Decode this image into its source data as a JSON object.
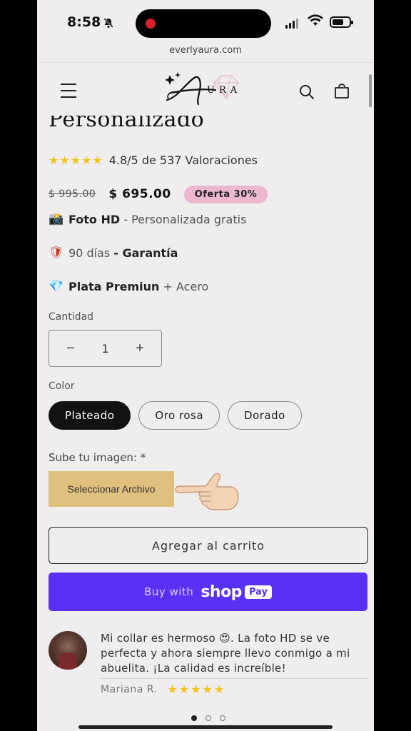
{
  "status_bar": {
    "time": "8:58",
    "icons": [
      "bell-slash-icon",
      "signal-icon",
      "wifi-icon",
      "battery-icon"
    ],
    "battery_level": 0.7
  },
  "browser": {
    "url": "everlyaura.com"
  },
  "header": {
    "logo_text": "URA",
    "icons": [
      "menu-icon",
      "search-icon",
      "cart-icon"
    ]
  },
  "product": {
    "title": "Personalizado",
    "rating": {
      "stars": "★★★★★",
      "text": "4.8/5 de 537 Valoraciones"
    },
    "old_price": "$ 995.00",
    "price": "$ 695.00",
    "badge": "Oferta 30%",
    "features": [
      {
        "icon": "📸",
        "bold": "Foto HD",
        "text": " - Personalizada gratis"
      },
      {
        "icon": "🛡",
        "prefix": "90 días ",
        "bold": "- Garantía"
      },
      {
        "icon": "💎",
        "bold": "Plata Premiun",
        "text": " + Acero"
      }
    ],
    "quantity": {
      "label": "Cantidad",
      "value": "1",
      "minus": "−",
      "plus": "+"
    },
    "color": {
      "label": "Color",
      "options": [
        "Plateado",
        "Oro rosa",
        "Dorado"
      ],
      "selected": "Plateado"
    },
    "upload": {
      "label": "Sube tu imagen: *",
      "button": "Seleccionar Archivo"
    },
    "add_to_cart": "Agregar al carrito",
    "shop_pay": {
      "prefix": "Buy with",
      "brand": "shop",
      "pay": "Pay"
    }
  },
  "review": {
    "text": "Mi collar es hermoso 😍. La foto HD se ve perfecta y ahora siempre llevo conmigo a mi abuelita. ¡La calidad es increíble!",
    "author": "Mariana R.",
    "stars": "★★★★★"
  },
  "carousel": {
    "total": 3,
    "active": 1
  },
  "colors": {
    "accent": "#5a31f4",
    "badge": "#ecb7cf",
    "upload_button": "#dfc07e",
    "star": "#f0c419"
  }
}
